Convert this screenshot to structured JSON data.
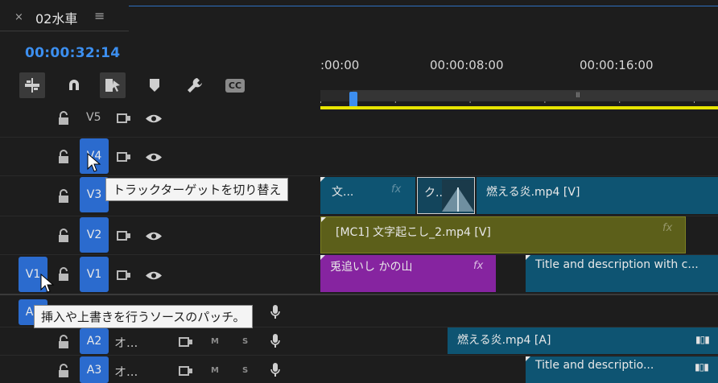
{
  "header": {
    "close": "×",
    "title": "02水車",
    "menu": "≡"
  },
  "timecode": "00:00:32:14",
  "tools": [
    {
      "icon": "insert-overwrite-icon"
    },
    {
      "icon": "snap-magnet-icon"
    },
    {
      "icon": "linked-selection-icon"
    },
    {
      "icon": "add-marker-icon"
    },
    {
      "icon": "wrench-settings-icon"
    },
    {
      "icon": "captions-cc-icon"
    }
  ],
  "cc_label": "CC",
  "ruler": {
    "tc0": ":00:00",
    "tc1": "00:00:08:00",
    "tc2": "00:00:16:00",
    "grip": "III"
  },
  "video_tracks": [
    {
      "name": "V5",
      "target": ""
    },
    {
      "name": "V4",
      "target": "V4"
    },
    {
      "name": "V3",
      "target": "V3"
    },
    {
      "name": "V2",
      "target": "V2"
    },
    {
      "name": "V1",
      "target": "V1",
      "source": "V1"
    }
  ],
  "audio_tracks": [
    {
      "source": "A1",
      "label": "",
      "m": "",
      "s": ""
    },
    {
      "target": "A2",
      "label": "オ...",
      "m": "M",
      "s": "S"
    },
    {
      "target": "A3",
      "label": "オ...",
      "m": "M",
      "s": "S"
    }
  ],
  "clips": {
    "v3_a": "文...",
    "v3_b": "ク...",
    "v3_c": "燃える炎.mp4 [V]",
    "v2": "[MC1] 文字起こし_2.mp4 [V]",
    "v1_a": "兎追いし かの山",
    "v1_b": "Title and description with c...",
    "a2": "燃える炎.mp4 [A]",
    "a3": "Title and descriptio...",
    "fx": "fx"
  },
  "tooltips": {
    "track_target": "トラックターゲットを切り替え",
    "source_patch": "挿入や上書きを行うソースのパッチ。"
  },
  "colors": {
    "accent": "#3c8ff0",
    "target": "#2b6bce",
    "workarea": "#e9e600"
  }
}
